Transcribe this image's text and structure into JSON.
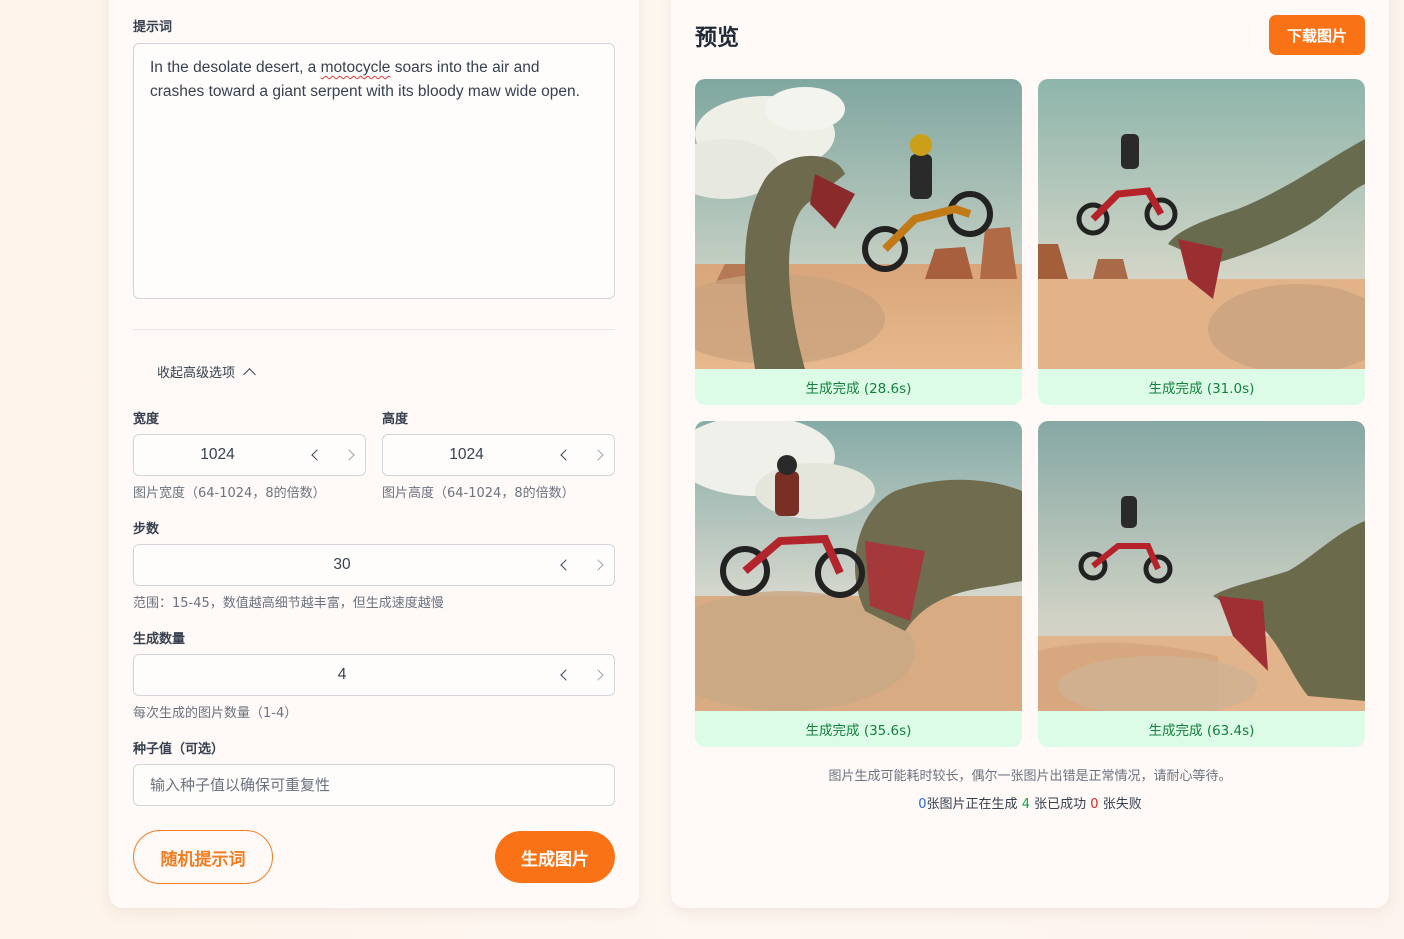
{
  "form": {
    "prompt_label": "提示词",
    "prompt_pre": "In the desolate desert, a ",
    "prompt_misspelled": "motocycle",
    "prompt_post": " soars into the air and crashes toward a giant serpent with its bloody maw wide open.",
    "advanced_toggle": "收起高级选项",
    "width": {
      "label": "宽度",
      "value": "1024",
      "hint": "图片宽度（64-1024，8的倍数）"
    },
    "height": {
      "label": "高度",
      "value": "1024",
      "hint": "图片高度（64-1024，8的倍数）"
    },
    "steps": {
      "label": "步数",
      "value": "30",
      "hint": "范围：15-45，数值越高细节越丰富，但生成速度越慢"
    },
    "count": {
      "label": "生成数量",
      "value": "4",
      "hint": "每次生成的图片数量（1-4）"
    },
    "seed": {
      "label": "种子值（可选）",
      "placeholder": "输入种子值以确保可重复性"
    },
    "random_button": "随机提示词",
    "generate_button": "生成图片"
  },
  "preview": {
    "title": "预览",
    "download_button": "下载图片",
    "images": [
      {
        "status": "生成完成 (28.6s)"
      },
      {
        "status": "生成完成 (31.0s)"
      },
      {
        "status": "生成完成 (35.6s)"
      },
      {
        "status": "生成完成 (63.4s)"
      }
    ],
    "note": "图片生成可能耗时较长，偶尔一张图片出错是正常情况，请耐心等待。",
    "counts": {
      "generating": "0",
      "generating_label": "张图片正在生成",
      "success": "4",
      "success_label": "张已成功",
      "failed": "0",
      "failed_label": "张失败"
    }
  },
  "colors": {
    "accent": "#f97316",
    "success_bg": "#dcfce7",
    "success_text": "#15803d"
  }
}
